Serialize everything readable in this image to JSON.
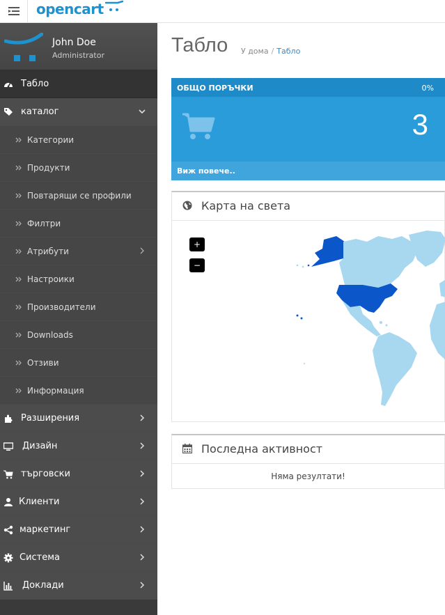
{
  "header": {
    "logo_text": "opencart",
    "menu_icon": "menu-toggle-icon"
  },
  "sidebar": {
    "user_name": "John Doe",
    "user_role": "Administrator",
    "items": [
      {
        "label": "Табло",
        "icon": "dashboard-icon",
        "active": true
      },
      {
        "label": "каталог",
        "icon": "tags-icon",
        "open": true
      },
      {
        "label": "Разширения",
        "icon": "puzzle-icon"
      },
      {
        "label": "Дизайн",
        "icon": "television-icon"
      },
      {
        "label": "търговски",
        "icon": "shopping-cart-icon"
      },
      {
        "label": "Клиенти",
        "icon": "user-icon"
      },
      {
        "label": "маркетинг",
        "icon": "share-icon"
      },
      {
        "label": "Система",
        "icon": "cog-icon"
      },
      {
        "label": "Доклади",
        "icon": "bar-chart-icon"
      }
    ],
    "catalog_sub": [
      {
        "label": "Категории"
      },
      {
        "label": "Продукти"
      },
      {
        "label": "Повтарящи се профили"
      },
      {
        "label": "Филтри"
      },
      {
        "label": "Атрибути",
        "has_children": true
      },
      {
        "label": "Настроики"
      },
      {
        "label": "Производители"
      },
      {
        "label": "Downloads"
      },
      {
        "label": "Отзиви"
      },
      {
        "label": "Информация"
      }
    ]
  },
  "main": {
    "title": "Табло",
    "breadcrumb": [
      "У дома",
      "Табло"
    ],
    "orders_tile": {
      "title": "ОБЩО ПОРЪЧКИ",
      "percent": "0%",
      "value": "3",
      "more_link": "Виж повече.."
    },
    "map_panel": {
      "title": "Карта на света",
      "zoom_in": "+",
      "zoom_out": "−"
    },
    "activity_panel": {
      "title": "Последна активност",
      "empty_text": "Няма резултати!"
    }
  },
  "colors": {
    "accent": "#1e91cf",
    "sidebar_bg": "#3a3a3a",
    "tile_bg": "#2a9cd9",
    "tile_head": "#1e8ac7",
    "map_highlight": "#0b56c9",
    "map_land": "#a8d7f0"
  }
}
